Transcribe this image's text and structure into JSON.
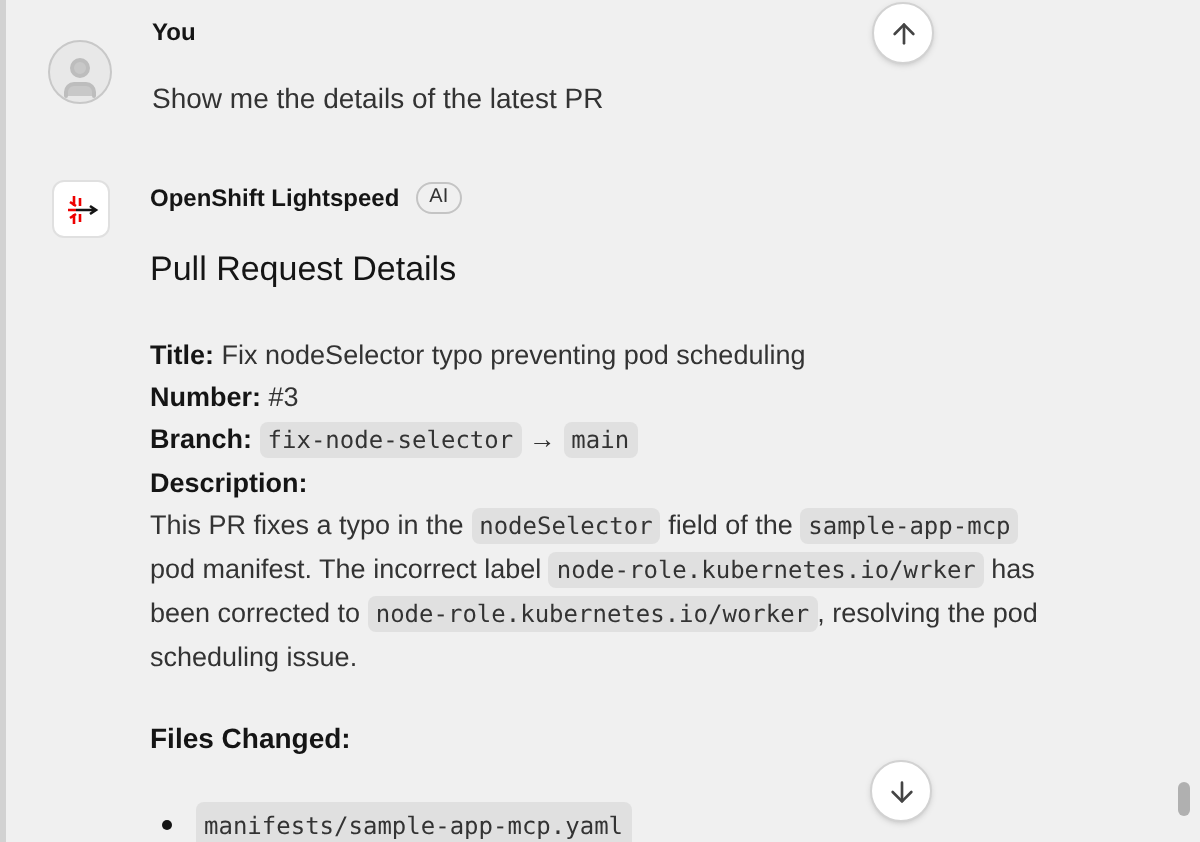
{
  "user_message": {
    "author": "You",
    "text": "Show me the details of the latest PR"
  },
  "bot_message": {
    "author": "OpenShift Lightspeed",
    "badge": "AI",
    "heading": "Pull Request Details",
    "fields": [
      {
        "segments": [
          {
            "kind": "label",
            "text": "Title:"
          },
          {
            "kind": "text",
            "text": "Fix nodeSelector typo preventing pod scheduling"
          }
        ]
      },
      {
        "segments": [
          {
            "kind": "label",
            "text": "Number:"
          },
          {
            "kind": "text",
            "text": "#3"
          }
        ]
      },
      {
        "segments": [
          {
            "kind": "label",
            "text": "Branch:"
          },
          {
            "kind": "code",
            "text": "fix-node-selector"
          },
          {
            "kind": "text",
            "text": "→"
          },
          {
            "kind": "code",
            "text": "main"
          }
        ]
      },
      {
        "segments": [
          {
            "kind": "label",
            "text": "Description:"
          }
        ]
      },
      {
        "segments": [
          {
            "kind": "text",
            "text": "This PR fixes a typo in the"
          },
          {
            "kind": "code",
            "text": "nodeSelector"
          },
          {
            "kind": "text",
            "text": "field of the"
          },
          {
            "kind": "code",
            "text": "sample-app-mcp"
          },
          {
            "kind": "text",
            "text": "pod manifest. The incorrect label"
          },
          {
            "kind": "code",
            "text": "node-role.kubernetes.io/wrker"
          },
          {
            "kind": "text",
            "text": "has been corrected to"
          },
          {
            "kind": "code",
            "text": "node-role.kubernetes.io/worker"
          },
          {
            "kind": "text",
            "text": ", resolving the pod scheduling issue."
          }
        ]
      }
    ],
    "files_heading": "Files Changed:",
    "files": [
      "manifests/sample-app-mcp.yaml"
    ]
  }
}
